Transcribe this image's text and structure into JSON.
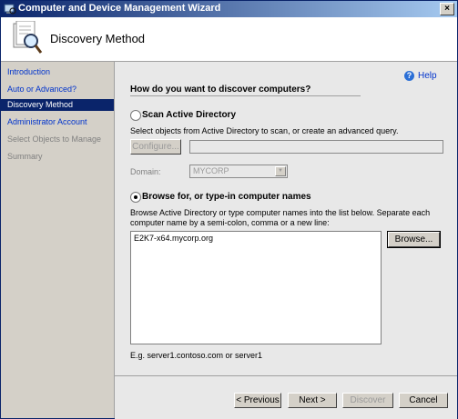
{
  "window": {
    "title": "Computer and Device Management Wizard",
    "close_glyph": "×"
  },
  "header": {
    "title": "Discovery Method"
  },
  "sidebar": {
    "items": [
      {
        "label": "Introduction",
        "state": "link"
      },
      {
        "label": "Auto or Advanced?",
        "state": "link"
      },
      {
        "label": "Discovery Method",
        "state": "active"
      },
      {
        "label": "Administrator Account",
        "state": "link"
      },
      {
        "label": "Select Objects to Manage",
        "state": "disabled"
      },
      {
        "label": "Summary",
        "state": "disabled"
      }
    ]
  },
  "help": {
    "label": "Help",
    "icon": "help-icon",
    "glyph": "?"
  },
  "main": {
    "question": "How do you want to discover computers?",
    "scan_ad": {
      "label": "Scan Active Directory",
      "checked": false,
      "description": "Select objects from Active Directory to scan, or create an advanced query.",
      "configure_label": "Configure...",
      "query_value": "",
      "domain_label": "Domain:",
      "domain_value": "MYCORP"
    },
    "browse": {
      "label": "Browse for, or type-in computer names",
      "checked": true,
      "description_line1": "Browse Active Directory or type computer names into the list below. Separate each",
      "description_line2": "computer name by a semi-colon, comma or a new line:",
      "computer_names": "E2K7-x64.mycorp.org",
      "browse_label": "Browse..."
    },
    "example": "E.g. server1.contoso.com or server1"
  },
  "footer": {
    "previous_label": "< Previous",
    "next_label": "Next >",
    "discover_label": "Discover",
    "cancel_label": "Cancel"
  }
}
